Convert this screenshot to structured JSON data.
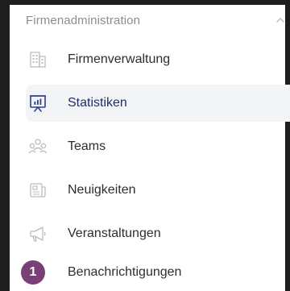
{
  "section": {
    "title": "Firmenadministration",
    "collapse_icon": "chevron-up-icon"
  },
  "nav": {
    "items": [
      {
        "label": "Firmenverwaltung",
        "icon": "building-icon",
        "active": false
      },
      {
        "label": "Statistiken",
        "icon": "statistics-board-icon",
        "active": true
      },
      {
        "label": "Teams",
        "icon": "team-icon",
        "active": false
      },
      {
        "label": "Neuigkeiten",
        "icon": "news-icon",
        "active": false
      },
      {
        "label": "Veranstaltungen",
        "icon": "megaphone-icon",
        "active": false
      },
      {
        "label": "Benachrichtigungen",
        "icon": "notification-badge",
        "badge": "1",
        "active": false
      }
    ]
  },
  "colors": {
    "active_bg": "#f3f4f6",
    "active_text": "#1f2d6b",
    "active_icon": "#2f3e8f",
    "inactive_icon": "#b8bcc2",
    "badge_bg": "#7b3f78"
  }
}
